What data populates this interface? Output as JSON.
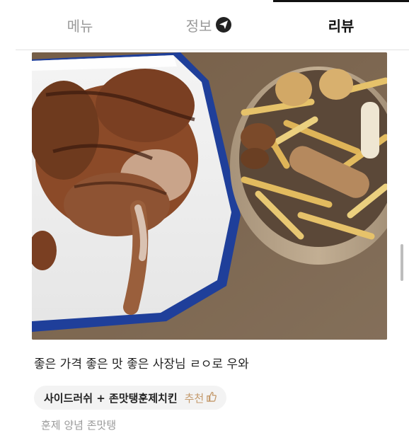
{
  "tabs": [
    {
      "label": "메뉴"
    },
    {
      "label": "정보",
      "icon": "send-icon"
    },
    {
      "label": "리뷰",
      "active": true
    }
  ],
  "review": {
    "text": "좋은 가격 좋은 맛 좋은 사장님 ㄹㅇ로 우와",
    "menu_chip": "사이드러쉬 + 존맛탱훈제치킨",
    "recommend_label": "추천",
    "sub_text": "훈제 양념 존맛탱"
  },
  "colors": {
    "accent_recommend": "#c49a6c",
    "chip_bg": "#f3f3f3"
  }
}
